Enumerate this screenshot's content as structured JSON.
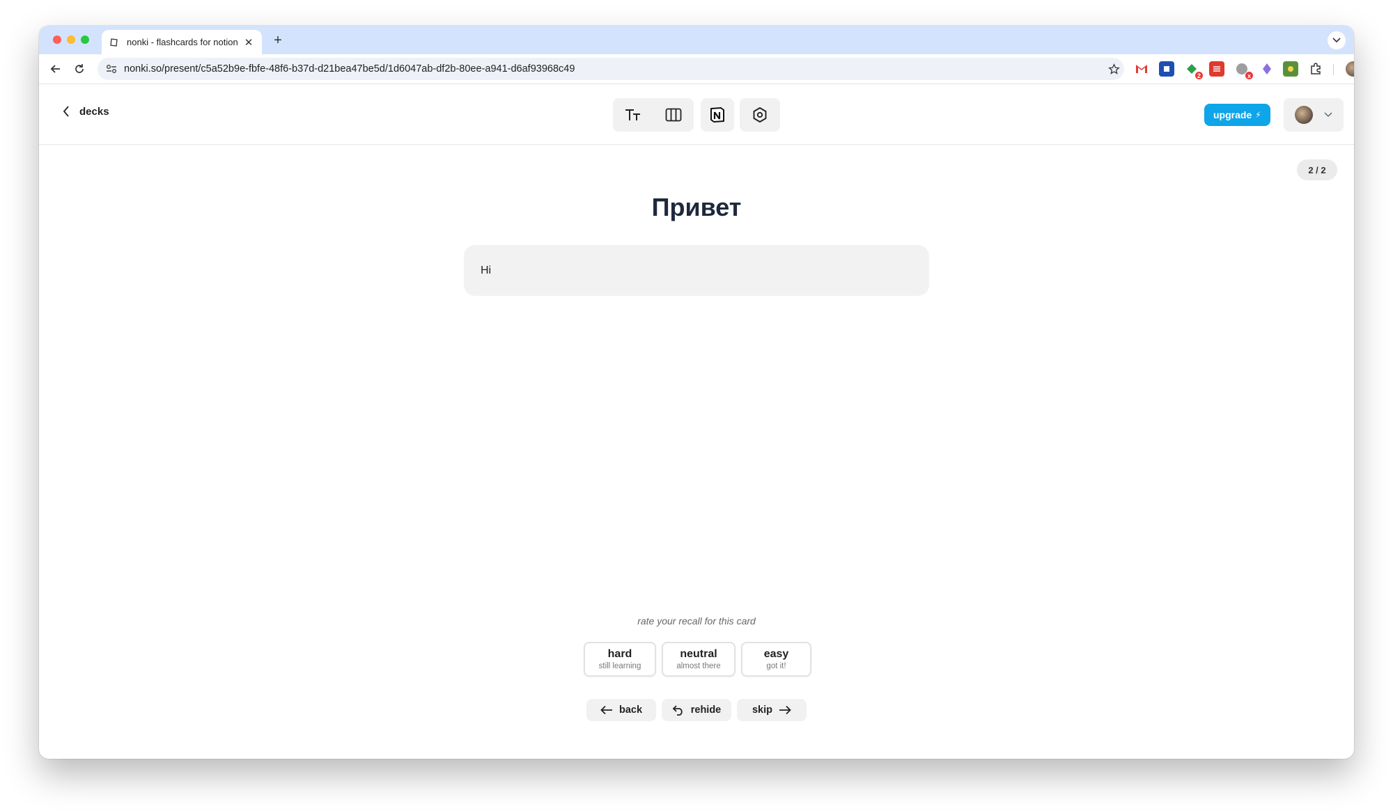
{
  "browser": {
    "tab_title": "nonki - flashcards for notion",
    "url": "nonki.so/present/c5a52b9e-fbfe-48f6-b37d-d21bea47be5d/1d6047ab-df2b-80ee-a941-d6af93968c49",
    "extension_badges": {
      "ext3": "2",
      "ext5": "x"
    }
  },
  "header": {
    "back_label": "decks",
    "upgrade_label": "upgrade",
    "upgrade_icon": "⚡"
  },
  "card": {
    "counter": "2 / 2",
    "question": "Привет",
    "answer": "Hi"
  },
  "rating": {
    "prompt": "rate your recall for this card",
    "buttons": [
      {
        "label": "hard",
        "sub": "still learning"
      },
      {
        "label": "neutral",
        "sub": "almost there"
      },
      {
        "label": "easy",
        "sub": "got it!"
      }
    ]
  },
  "actions": {
    "back": "back",
    "rehide": "rehide",
    "skip": "skip"
  },
  "colors": {
    "accent": "#0ea5e9",
    "tabstrip": "#d3e3fd",
    "title": "#1e293b"
  }
}
